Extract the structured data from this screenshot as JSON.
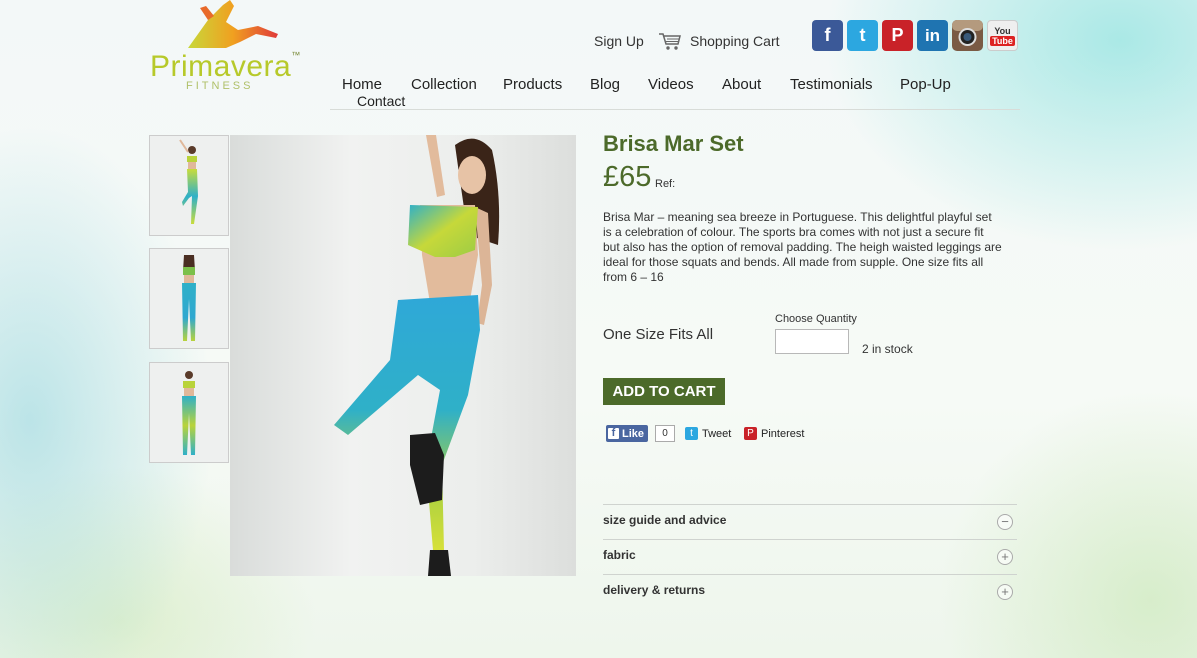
{
  "brand": {
    "name": "Primavera",
    "sub": "FITNESS",
    "tm": "™"
  },
  "header": {
    "signup": "Sign Up",
    "cart": "Shopping Cart"
  },
  "social": [
    {
      "icon": "facebook-icon",
      "label": "f",
      "color": "#3b5998"
    },
    {
      "icon": "twitter-icon",
      "label": "t",
      "color": "#2ca7e0"
    },
    {
      "icon": "pinterest-icon",
      "label": "P",
      "color": "#c92228"
    },
    {
      "icon": "linkedin-icon",
      "label": "in",
      "color": "#1f74b1"
    },
    {
      "icon": "instagram-icon",
      "label": "",
      "color": "#6b4a35"
    },
    {
      "icon": "youtube-icon",
      "label": "You Tube",
      "color": "#efefef"
    }
  ],
  "nav": [
    "Home",
    "Collection",
    "Products",
    "Blog",
    "Videos",
    "About",
    "Testimonials",
    "Pop-Up",
    "Contact"
  ],
  "product": {
    "title": "Brisa Mar Set",
    "price": "£65",
    "ref": "Ref:",
    "description": "Brisa Mar – meaning sea breeze in Portuguese. This delightful playful set is a celebration of colour. The sports bra comes with not just a secure fit but also has the option of removal padding. The heigh waisted leggings are ideal for those squats and bends. All made from supple. One size fits all from 6 – 16",
    "size": "One Size Fits All",
    "qty_label": "Choose Quantity",
    "qty_value": "",
    "stock": "2 in stock",
    "add_to_cart": "ADD TO CART"
  },
  "share": {
    "like": "Like",
    "like_count": "0",
    "tweet": "Tweet",
    "pinterest": "Pinterest"
  },
  "accordion": [
    {
      "label": "size guide and advice",
      "toggle": "−"
    },
    {
      "label": "fabric",
      "toggle": "+"
    },
    {
      "label": "delivery & returns",
      "toggle": "+"
    }
  ],
  "colors": {
    "accent": "#4c6a2a",
    "teal": "#2fb0c8",
    "lime": "#c8dc3a"
  }
}
